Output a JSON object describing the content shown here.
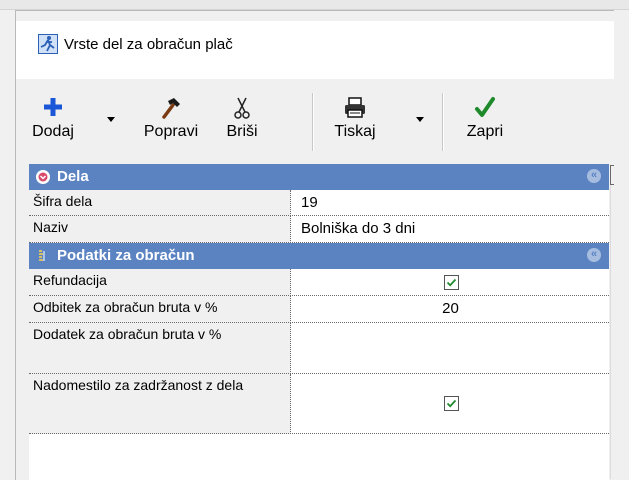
{
  "window": {
    "title": "Vrste del za obračun plač"
  },
  "toolbar": {
    "add_label": "Dodaj",
    "edit_label": "Popravi",
    "delete_label": "Briši",
    "print_label": "Tiskaj",
    "close_label": "Zapri"
  },
  "grid": {
    "category_dela": "Dela",
    "category_podatki": "Podatki za obračun",
    "rows": [
      {
        "name": "Šifra dela",
        "value": "19"
      },
      {
        "name": "Naziv",
        "value": "Bolniška do 3 dni"
      },
      {
        "name": "Refundacija",
        "checked": true
      },
      {
        "name": "Odbitek za obračun bruta v %",
        "value": "20"
      },
      {
        "name": "Dodatek za obračun bruta v %",
        "value": ""
      },
      {
        "name": "Nadomestilo za zadržanost z dela",
        "checked": true
      }
    ]
  },
  "colors": {
    "category_header": "#5b83c2",
    "checkmark": "#1f8a2c",
    "add_icon": "#1a56d6"
  }
}
